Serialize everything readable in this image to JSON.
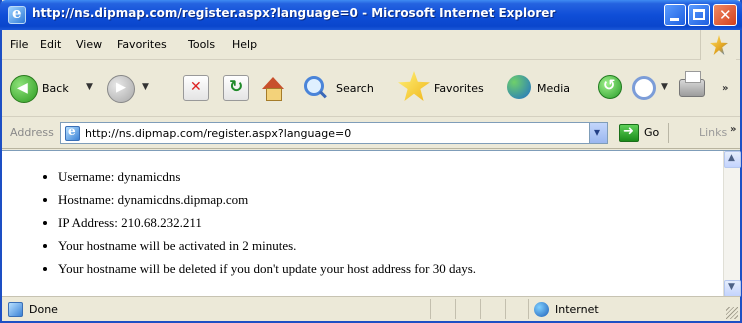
{
  "window": {
    "title": "http://ns.dipmap.com/register.aspx?language=0 - Microsoft Internet Explorer"
  },
  "menu": [
    "File",
    "Edit",
    "View",
    "Favorites",
    "Tools",
    "Help"
  ],
  "toolbar": {
    "back_label": "Back",
    "search_label": "Search",
    "favorites_label": "Favorites",
    "media_label": "Media"
  },
  "address": {
    "label": "Address",
    "url": "http://ns.dipmap.com/register.aspx?language=0",
    "go_label": "Go",
    "links_label": "Links"
  },
  "content": {
    "items": [
      "Username: dynamicdns",
      "Hostname: dynamicdns.dipmap.com",
      "IP Address: 210.68.232.211",
      "Your hostname will be activated in 2 minutes.",
      "Your hostname will be deleted if you don't update your host address for 30 days."
    ]
  },
  "status": {
    "text": "Done",
    "zone": "Internet"
  },
  "colors": {
    "titlebar": "#0f4ed8",
    "chrome": "#ece9d8",
    "accent_border": "#1d4fc4"
  }
}
